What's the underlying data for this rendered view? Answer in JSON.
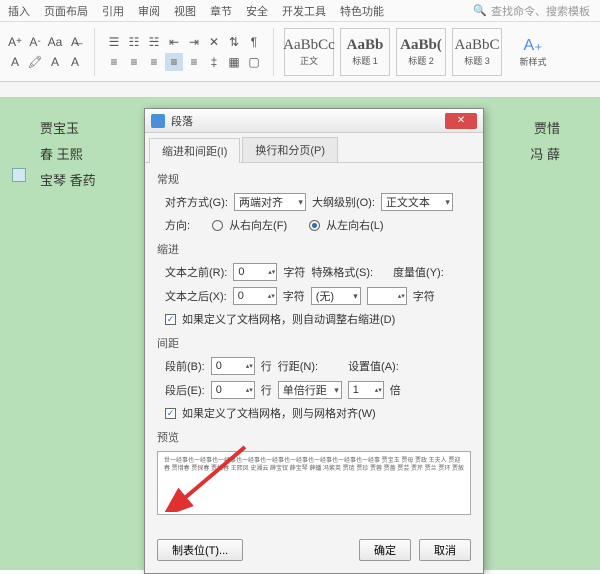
{
  "ribbon": {
    "tabs": [
      "插入",
      "页面布局",
      "引用",
      "审阅",
      "视图",
      "章节",
      "安全",
      "开发工具",
      "特色功能"
    ],
    "search_placeholder": "查找命令、搜索模板",
    "styles": [
      {
        "preview": "AaBbCc",
        "label": "正文",
        "bold": false
      },
      {
        "preview": "AaBb",
        "label": "标题 1",
        "bold": true
      },
      {
        "preview": "AaBb(",
        "label": "标题 2",
        "bold": true
      },
      {
        "preview": "AaBbC",
        "label": "标题 3",
        "bold": false
      }
    ],
    "new_style": "新样式"
  },
  "document": {
    "line1": "贾宝玉",
    "line1_end": "贾惜",
    "line2": "春 王熙",
    "line2_end": "冯 薛",
    "line3": "宝琴 香药"
  },
  "dialog": {
    "title": "段落",
    "tabs": [
      "缩进和间距(I)",
      "换行和分页(P)"
    ],
    "sections": {
      "general": "常规",
      "indent": "缩进",
      "spacing": "间距",
      "preview": "预览"
    },
    "general": {
      "align_label": "对齐方式(G):",
      "align_value": "两端对齐",
      "outline_label": "大纲级别(O):",
      "outline_value": "正文文本",
      "direction_label": "方向:",
      "rtl": "从右向左(F)",
      "ltr": "从左向右(L)"
    },
    "indent": {
      "before_label": "文本之前(R):",
      "before_value": "0",
      "before_unit": "字符",
      "special_label": "特殊格式(S):",
      "special_value": "(无)",
      "measure_label": "度量值(Y):",
      "after_label": "文本之后(X):",
      "after_value": "0",
      "after_unit": "字符",
      "char_unit": "字符",
      "auto_adjust": "如果定义了文档网格，则自动调整右缩进(D)"
    },
    "spacing": {
      "before_label": "段前(B):",
      "before_value": "0",
      "before_unit": "行",
      "line_label": "行距(N):",
      "line_value": "单倍行距",
      "set_label": "设置值(A):",
      "set_value": "1",
      "set_unit": "倍",
      "after_label": "段后(E):",
      "after_value": "0",
      "after_unit": "行",
      "grid_align": "如果定义了文档网格，则与网格对齐(W)"
    },
    "preview_text": "世一经事也一经事也一经事也一经事也一经事也一经事也一经事也一经事也一经事 贾宝玉 贾母 贾政 王夫人 贾迎春 贾惜春 贾探春 贾惜春 王熙凤 史湘云 薛宝钗 薛宝琴 薛蟠 冯紫英 贾琏 贾珍 贾蓉 贾蔷 贾芸 贾芹 贾兰 贾环 贾赦",
    "buttons": {
      "tabs": "制表位(T)...",
      "ok": "确定",
      "cancel": "取消"
    }
  }
}
